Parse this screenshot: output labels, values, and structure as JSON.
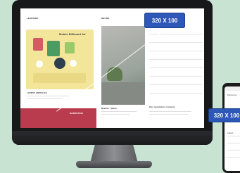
{
  "ad": {
    "desktop_size_label": "320 X 100",
    "phone_size_label": "320 X 100"
  },
  "screen": {
    "col_a_header": "LEARNING",
    "hero_title": "Mobile Billboard Ad",
    "latest_label": "LATEST ARTICLES",
    "col_b_header": "BRAND",
    "col_c_header": "MARKETING",
    "bottom_b_title": "Brands / Ideas",
    "bottom_c_title": "Our newsletter contacts",
    "dark_card_label": "MARKETING"
  },
  "phone": {
    "header": "Marketing",
    "section": "Latest"
  },
  "colors": {
    "background": "#c9e3d3",
    "ad_badge": "#2d57b8",
    "hero_card": "#f3e59a",
    "dark_card": "#b93c4e"
  }
}
